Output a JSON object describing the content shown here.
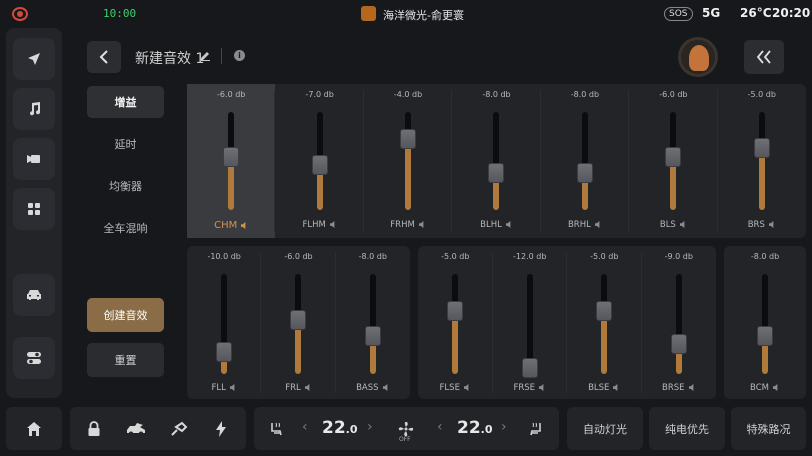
{
  "status": {
    "battery": "10:00",
    "song": "海洋微光-俞更寰",
    "sos": "SOS",
    "network": "5G",
    "temperature": "26°C",
    "time": "20:20"
  },
  "header": {
    "title": "新建音效 1"
  },
  "menu": {
    "items": [
      "增益",
      "延时",
      "均衡器",
      "全车混响"
    ],
    "create": "创建音效",
    "reset": "重置"
  },
  "channels_top": [
    {
      "name": "CHM",
      "value": "-6.0 db",
      "level": 0.54,
      "selected": true
    },
    {
      "name": "FLHM",
      "value": "-7.0 db",
      "level": 0.46,
      "selected": false
    },
    {
      "name": "FRHM",
      "value": "-4.0 db",
      "level": 0.72,
      "selected": false
    },
    {
      "name": "BLHL",
      "value": "-8.0 db",
      "level": 0.38,
      "selected": false
    },
    {
      "name": "BRHL",
      "value": "-8.0 db",
      "level": 0.38,
      "selected": false
    },
    {
      "name": "BLS",
      "value": "-6.0 db",
      "level": 0.54,
      "selected": false
    },
    {
      "name": "BRS",
      "value": "-5.0 db",
      "level": 0.63,
      "selected": false
    }
  ],
  "channels_front": [
    {
      "name": "FLL",
      "value": "-10.0 db",
      "level": 0.22
    },
    {
      "name": "FRL",
      "value": "-6.0 db",
      "level": 0.54
    },
    {
      "name": "BASS",
      "value": "-8.0 db",
      "level": 0.38
    }
  ],
  "channels_rear": [
    {
      "name": "FLSE",
      "value": "-5.0 db",
      "level": 0.63
    },
    {
      "name": "FRSE",
      "value": "-12.0 db",
      "level": 0.06
    },
    {
      "name": "BLSE",
      "value": "-5.0 db",
      "level": 0.63
    },
    {
      "name": "BRSE",
      "value": "-9.0 db",
      "level": 0.3
    }
  ],
  "channels_center": [
    {
      "name": "BCM",
      "value": "-8.0 db",
      "level": 0.38
    }
  ],
  "climate": {
    "left_temp": "22",
    "left_temp_dec": ".0",
    "right_temp": "22",
    "right_temp_dec": ".0",
    "fan_state": "OFF"
  },
  "dock": {
    "auto_light": "自动灯光",
    "ev_priority": "纯电优先",
    "special_road": "特殊路况"
  },
  "colors": {
    "accent": "#b07a3c",
    "selected_label": "#d2924a",
    "create_button": "#8a6d47"
  }
}
